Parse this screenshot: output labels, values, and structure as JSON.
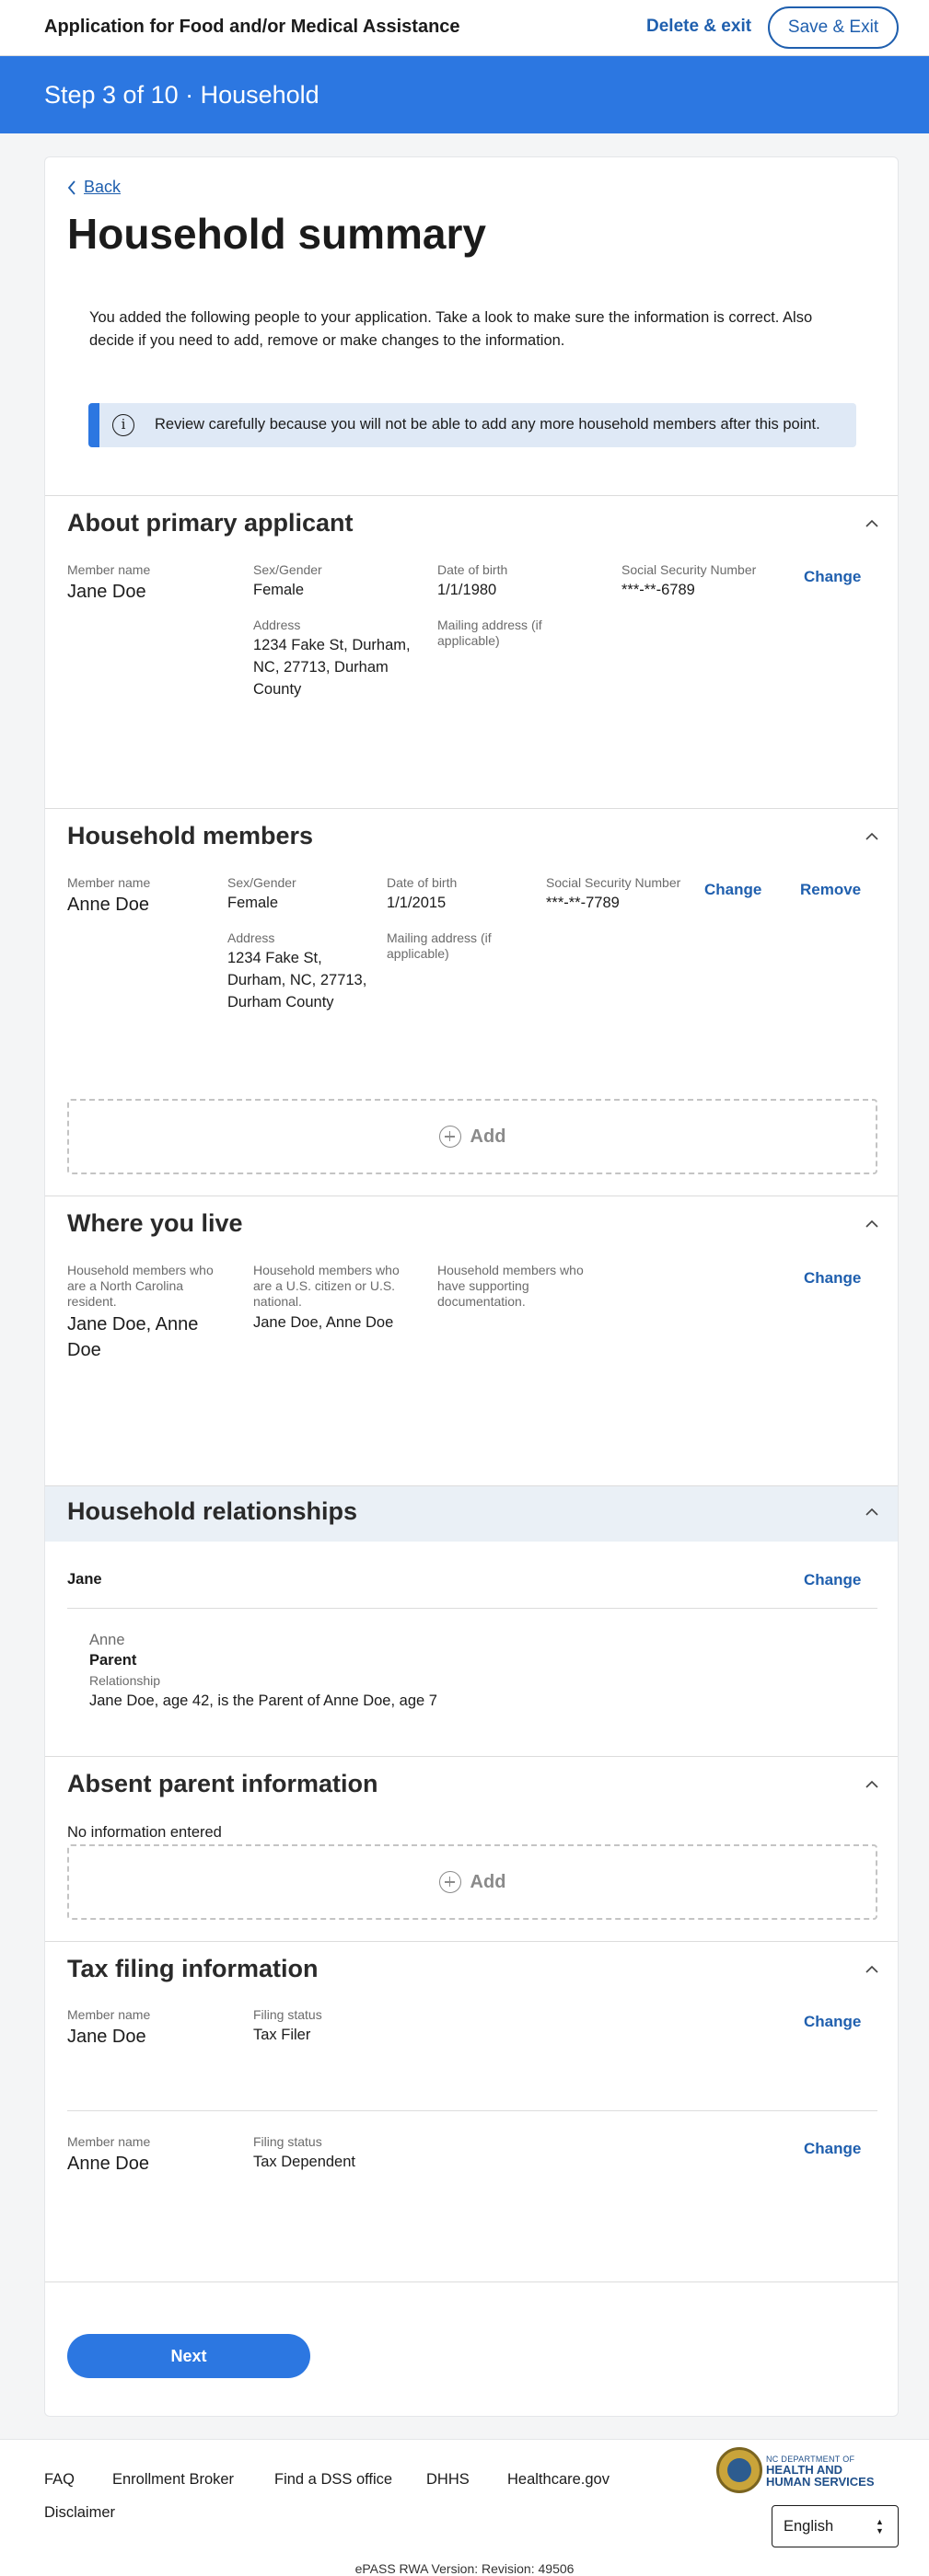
{
  "header": {
    "app_title": "Application for Food and/or Medical Assistance",
    "delete_exit": "Delete & exit",
    "save_exit": "Save & Exit"
  },
  "step": {
    "label": "Step 3 of 10 · Household"
  },
  "page": {
    "back": "Back",
    "title": "Household summary",
    "intro": "You added the following people to your application. Take a look to make sure the information is correct. Also decide if you need to add, remove or make changes to the information.",
    "alert": "Review carefully because you will not be able to add any more household members after this point."
  },
  "primary": {
    "title": "About primary applicant",
    "member_name_label": "Member name",
    "member_name": "Jane Doe",
    "sex_label": "Sex/Gender",
    "sex": "Female",
    "dob_label": "Date of birth",
    "dob": "1/1/1980",
    "ssn_label": "Social Security Number",
    "ssn": "***-**-6789",
    "change": "Change",
    "address_label": "Address",
    "address": "1234 Fake St, Durham, NC, 27713, Durham County",
    "mailing_label": "Mailing address (if applicable)"
  },
  "household": {
    "title": "Household members",
    "member_name_label": "Member name",
    "member_name": "Anne Doe",
    "sex_label": "Sex/Gender",
    "sex": "Female",
    "dob_label": "Date of birth",
    "dob": "1/1/2015",
    "ssn_label": "Social Security Number",
    "ssn": "***-**-7789",
    "change": "Change",
    "remove": "Remove",
    "address_label": "Address",
    "address": "1234 Fake St, Durham, NC, 27713, Durham County",
    "mailing_label": "Mailing address (if applicable)",
    "add": "Add"
  },
  "live": {
    "title": "Where you live",
    "nc_label": "Household members who are a North Carolina resident.",
    "nc_value": "Jane Doe, Anne Doe",
    "citizen_label": "Household members who are a U.S. citizen or U.S. national.",
    "citizen_value": "Jane Doe, Anne Doe",
    "docs_label": "Household members who have supporting documentation.",
    "change": "Change"
  },
  "relationships": {
    "title": "Household relationships",
    "person": "Jane",
    "change": "Change",
    "related_name": "Anne",
    "relation": "Parent",
    "relationship_label": "Relationship",
    "description": "Jane Doe, age 42, is the Parent of Anne Doe, age 7"
  },
  "absent": {
    "title": "Absent parent information",
    "empty": "No information entered",
    "add": "Add"
  },
  "tax": {
    "title": "Tax filing information",
    "rows": [
      {
        "member_label": "Member name",
        "member": "Jane Doe",
        "status_label": "Filing status",
        "status": "Tax Filer",
        "change": "Change"
      },
      {
        "member_label": "Member name",
        "member": "Anne Doe",
        "status_label": "Filing status",
        "status": "Tax Dependent",
        "change": "Change"
      }
    ]
  },
  "next": "Next",
  "footer": {
    "links": [
      "FAQ",
      "Enrollment Broker",
      "Find a DSS office",
      "DHHS",
      "Healthcare.gov",
      "Disclaimer"
    ],
    "brand_line1": "NC DEPARTMENT OF",
    "brand_line2a": "HEALTH AND",
    "brand_line2b": "HUMAN SERVICES",
    "language": "English",
    "version": "ePASS RWA Version: Revision: 49506"
  },
  "colors": {
    "primary": "#2c77e1",
    "link": "#1f5fae",
    "alert_bg": "#dfe9f6",
    "band_bg": "#eaf0f6"
  }
}
